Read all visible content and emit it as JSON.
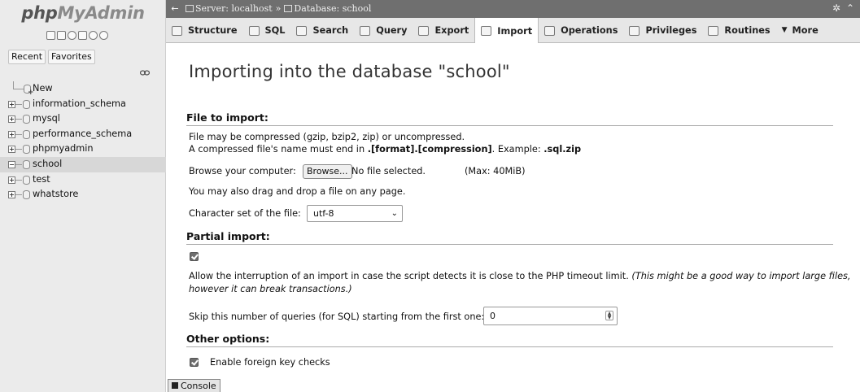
{
  "sidebar": {
    "logo": {
      "part1": "php",
      "part2": "MyAdmin"
    },
    "nav_icons": [
      "home-icon",
      "database-icon",
      "help-icon",
      "docs-icon",
      "settings-icon",
      "reload-icon"
    ],
    "recent_label": "Recent",
    "favorites_label": "Favorites",
    "new_label": "New",
    "databases": [
      {
        "name": "information_schema",
        "selected": false
      },
      {
        "name": "mysql",
        "selected": false
      },
      {
        "name": "performance_schema",
        "selected": false
      },
      {
        "name": "phpmyadmin",
        "selected": false
      },
      {
        "name": "school",
        "selected": true
      },
      {
        "name": "test",
        "selected": false
      },
      {
        "name": "whatstore",
        "selected": false
      }
    ]
  },
  "breadcrumb": {
    "server": "Server: localhost",
    "separator": "»",
    "database": "Database: school"
  },
  "tabs": [
    {
      "label": "Structure",
      "icon": "structure-icon",
      "active": false
    },
    {
      "label": "SQL",
      "icon": "sql-icon",
      "active": false
    },
    {
      "label": "Search",
      "icon": "search-icon",
      "active": false
    },
    {
      "label": "Query",
      "icon": "query-icon",
      "active": false
    },
    {
      "label": "Export",
      "icon": "export-icon",
      "active": false
    },
    {
      "label": "Import",
      "icon": "import-icon",
      "active": true
    },
    {
      "label": "Operations",
      "icon": "operations-icon",
      "active": false
    },
    {
      "label": "Privileges",
      "icon": "privileges-icon",
      "active": false
    },
    {
      "label": "Routines",
      "icon": "routines-icon",
      "active": false
    },
    {
      "label": "More",
      "icon": "chevron-down-icon",
      "active": false
    }
  ],
  "main": {
    "title": "Importing into the database \"school\"",
    "file_to_import": {
      "heading": "File to import:",
      "compress_note": "File may be compressed (gzip, bzip2, zip) or uncompressed.",
      "name_note_prefix": "A compressed file's name must end in ",
      "name_note_format": ".[format].[compression]",
      "name_note_example_prefix": ". Example: ",
      "name_note_example": ".sql.zip",
      "browse_label": "Browse your computer:",
      "browse_button": "Browse...",
      "no_file": "No file selected.",
      "max_size": "(Max: 40MiB)",
      "drag_note": "You may also drag and drop a file on any page.",
      "charset_label": "Character set of the file:",
      "charset_value": "utf-8"
    },
    "partial_import": {
      "heading": "Partial import:",
      "allow_interrupt_checked": true,
      "allow_interrupt_text": "Allow the interruption of an import in case the script detects it is close to the PHP timeout limit. ",
      "allow_interrupt_note_1": "(This might be a good way to import large files,",
      "allow_interrupt_note_2": "however it can break transactions.)",
      "skip_label": "Skip this number of queries (for SQL) starting from the first one:",
      "skip_value": "0"
    },
    "other_options": {
      "heading": "Other options:",
      "fk_checks_checked": true,
      "fk_checks_label": "Enable foreign key checks"
    }
  },
  "console": {
    "label": "Console"
  },
  "colors": {
    "topbar": "#6f6f6f",
    "sidebar": "#ebebeb",
    "tabbar": "#e7e7e7",
    "selected_row": "#d7d7d7"
  }
}
